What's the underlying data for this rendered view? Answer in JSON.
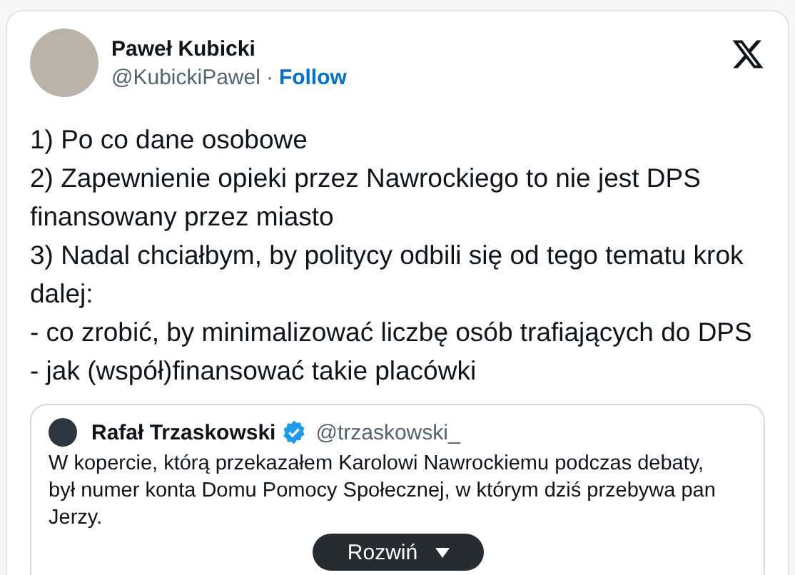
{
  "author": {
    "name": "Paweł Kubicki",
    "handle": "@KubickiPawel",
    "separator": "·",
    "follow": "Follow"
  },
  "body": [
    "1) Po co dane osobowe",
    "2) Zapewnienie opieki przez Nawrockiego to nie jest DPS finansowany przez miasto",
    "3) Nadal chciałbym, by politycy odbili się od tego tematu krok dalej:",
    "- co zrobić, by minimalizować liczbę osób trafiających do DPS",
    "- jak (współ)finansować takie placówki"
  ],
  "quote": {
    "name": "Rafał Trzaskowski",
    "verified": true,
    "handle": "@trzaskowski_",
    "text": "W kopercie, którą przekazałem Karolowi Nawrockiemu podczas debaty, był numer konta Domu Pomocy Społecznej, w którym dziś przebywa pan Jerzy.",
    "expand": "Rozwiń"
  }
}
